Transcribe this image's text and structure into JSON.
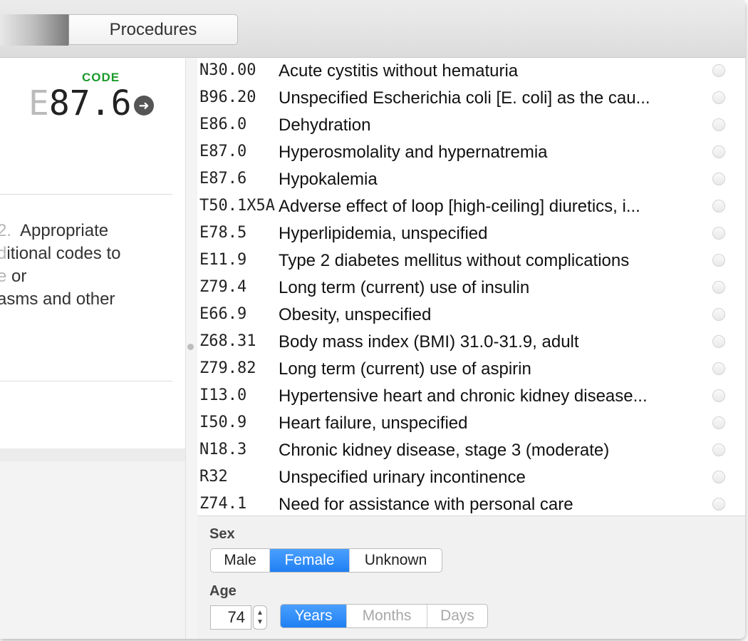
{
  "toolbar": {
    "tab_label": "Procedures"
  },
  "left": {
    "code_label": "CODE",
    "code_prefix": "E",
    "code_rest": "87.6",
    "note_lines": [
      {
        "fade": "2.",
        "text": "  Appropriate"
      },
      {
        "fade": "d",
        "text": "itional codes to"
      },
      {
        "fade": "e",
        "text": " or"
      },
      {
        "fade": "",
        "text": "asms and other"
      }
    ]
  },
  "codes": [
    {
      "code": "N30.00",
      "desc": "Acute cystitis without hematuria"
    },
    {
      "code": "B96.20",
      "desc": "Unspecified Escherichia coli [E. coli] as the cau..."
    },
    {
      "code": "E86.0",
      "desc": "Dehydration"
    },
    {
      "code": "E87.0",
      "desc": "Hyperosmolality and hypernatremia"
    },
    {
      "code": "E87.6",
      "desc": "Hypokalemia"
    },
    {
      "code": "T50.1X5A",
      "desc": "Adverse effect of loop [high-ceiling] diuretics, i..."
    },
    {
      "code": "E78.5",
      "desc": "Hyperlipidemia, unspecified"
    },
    {
      "code": "E11.9",
      "desc": "Type 2 diabetes mellitus without complications"
    },
    {
      "code": "Z79.4",
      "desc": "Long term (current) use of insulin"
    },
    {
      "code": "E66.9",
      "desc": "Obesity, unspecified"
    },
    {
      "code": "Z68.31",
      "desc": "Body mass index (BMI) 31.0-31.9, adult"
    },
    {
      "code": "Z79.82",
      "desc": "Long term (current) use of aspirin"
    },
    {
      "code": "I13.0",
      "desc": "Hypertensive heart and chronic kidney disease..."
    },
    {
      "code": "I50.9",
      "desc": "Heart failure, unspecified"
    },
    {
      "code": "N18.3",
      "desc": "Chronic kidney disease, stage 3 (moderate)"
    },
    {
      "code": "R32",
      "desc": "Unspecified urinary incontinence"
    },
    {
      "code": "Z74.1",
      "desc": "Need for assistance with personal care"
    }
  ],
  "sex": {
    "label": "Sex",
    "options": [
      "Male",
      "Female",
      "Unknown"
    ],
    "selected": "Female"
  },
  "age": {
    "label": "Age",
    "value": "74",
    "units": [
      "Years",
      "Months",
      "Days"
    ],
    "selected_unit": "Years"
  },
  "colors": {
    "accent": "#1f7ff3",
    "code_label": "#1c9a2c"
  }
}
